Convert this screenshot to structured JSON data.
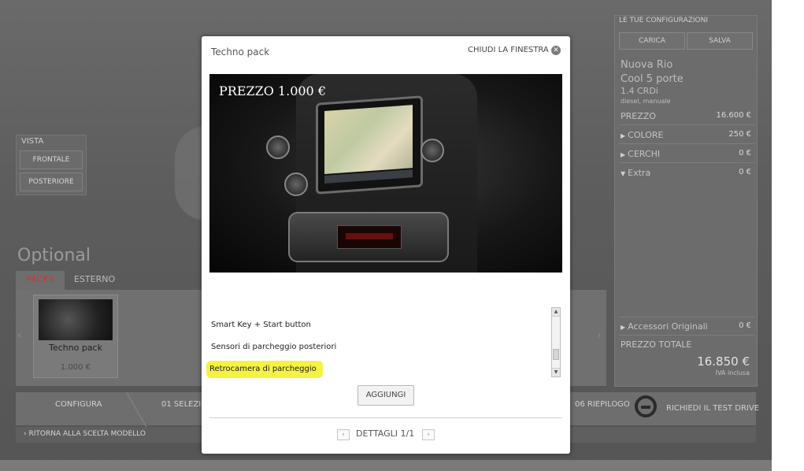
{
  "vista": {
    "title": "VISTA",
    "buttons": [
      "FRONTALE",
      "POSTERIORE"
    ]
  },
  "optional": {
    "title": "Optional",
    "tabs": [
      "PACKS",
      "ESTERNO"
    ],
    "pack_card": {
      "name": "Techno pack",
      "price": "1.000 €"
    }
  },
  "steps": {
    "configura": "CONFIGURA",
    "step1": "01 SELEZIO",
    "step6": "06 RIEPILOGO",
    "test_drive": "RICHIEDI IL TEST DRIVE",
    "back": "RITORNA ALLA SCELTA MODELLO"
  },
  "right_panel": {
    "header": "LE TUE CONFIGURAZIONI",
    "carica": "CARICA",
    "salva": "SALVA",
    "model_line1": "Nuova Rio",
    "model_line2": "Cool 5 porte",
    "engine": "1.4 CRDi",
    "engine_sub": "diesel, manuale",
    "prezzo_label": "PREZZO",
    "prezzo_value": "16.600 €",
    "colore_label": "COLORE",
    "colore_value": "250 €",
    "cerchi_label": "CERCHI",
    "cerchi_value": "0 €",
    "extra_label": "Extra",
    "extra_value": "0 €",
    "accessori_label": "Accessori Originali",
    "accessori_value": "0 €",
    "totale_label": "PREZZO TOTALE",
    "totale_value": "16.850 €",
    "iva": "IVA inclusa"
  },
  "modal": {
    "title": "Techno pack",
    "close_label": "CHIUDI LA FINESTRA",
    "price_overlay": "PREZZO 1.000  €",
    "items": [
      "Smart Key + Start button",
      "Sensori di parcheggio posteriori",
      "Retrocamera di parcheggio"
    ],
    "add_button": "AGGIUNGI",
    "pager": "DETTAGLI 1/1",
    "highlight_color": "#f6f244"
  }
}
